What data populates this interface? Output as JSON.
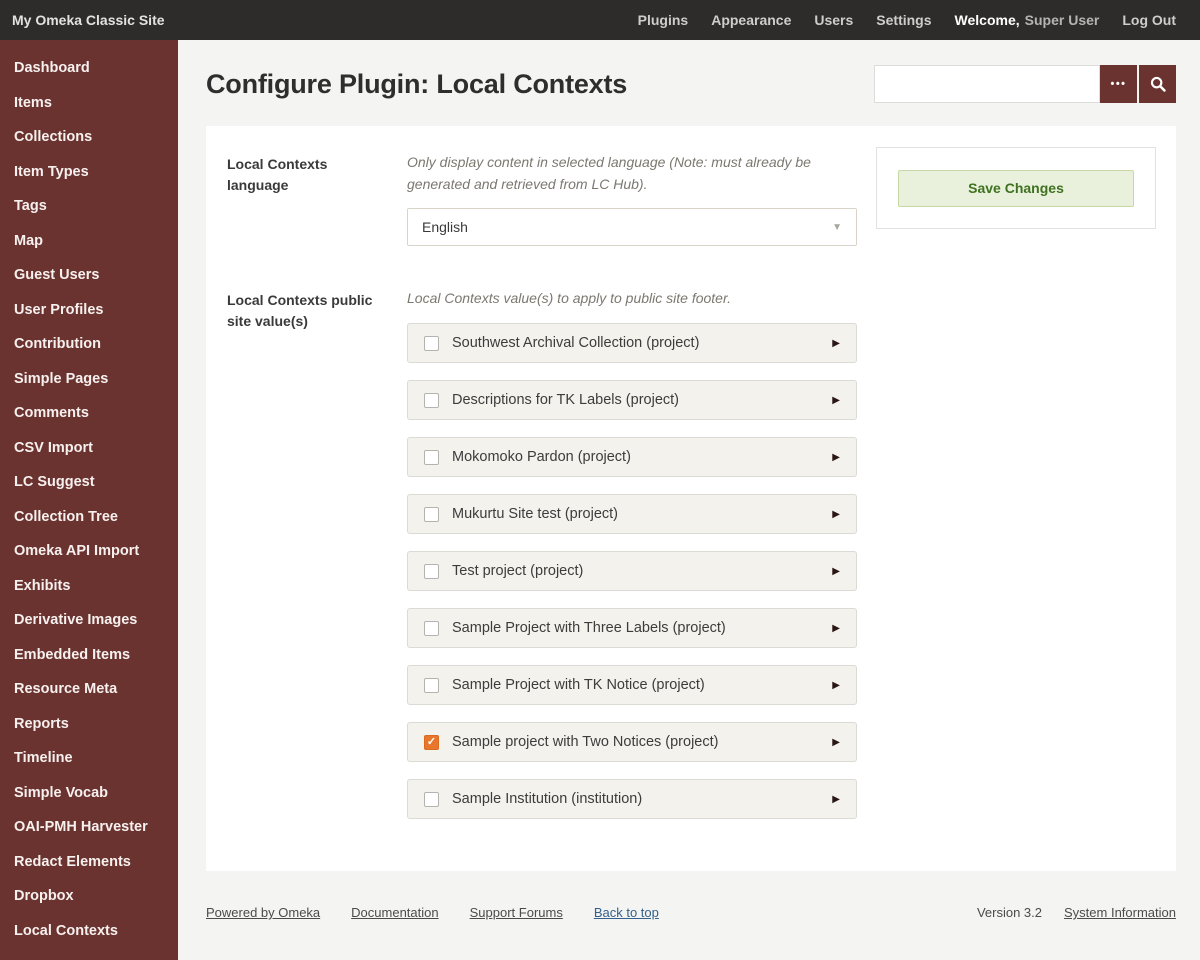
{
  "topbar": {
    "site_title": "My Omeka Classic Site",
    "nav": [
      "Plugins",
      "Appearance",
      "Users",
      "Settings"
    ],
    "welcome_bold": "Welcome,",
    "welcome_user": "Super User",
    "logout_label": "Log Out"
  },
  "sidebar": {
    "items": [
      "Dashboard",
      "Items",
      "Collections",
      "Item Types",
      "Tags",
      "Map",
      "Guest Users",
      "User Profiles",
      "Contribution",
      "Simple Pages",
      "Comments",
      "CSV Import",
      "LC Suggest",
      "Collection Tree",
      "Omeka API Import",
      "Exhibits",
      "Derivative Images",
      "Embedded Items",
      "Resource Meta",
      "Reports",
      "Timeline",
      "Simple Vocab",
      "OAI-PMH Harvester",
      "Redact Elements",
      "Dropbox",
      "Local Contexts"
    ]
  },
  "header": {
    "title": "Configure Plugin: Local Contexts",
    "search": {
      "value": "",
      "placeholder": ""
    }
  },
  "form": {
    "language_field": {
      "label": "Local Contexts language",
      "description": "Only display content in selected language (Note: must already be generated and retrieved from LC Hub).",
      "selected_value": "English"
    },
    "values_field": {
      "label": "Local Contexts public site value(s)",
      "description": "Local Contexts value(s) to apply to public site footer.",
      "options": [
        {
          "label": "Southwest Archival Collection (project)",
          "checked": false
        },
        {
          "label": "Descriptions for TK Labels (project)",
          "checked": false
        },
        {
          "label": "Mokomoko Pardon (project)",
          "checked": false
        },
        {
          "label": "Mukurtu Site test (project)",
          "checked": false
        },
        {
          "label": "Test project (project)",
          "checked": false
        },
        {
          "label": "Sample Project with Three Labels (project)",
          "checked": false
        },
        {
          "label": "Sample Project with TK Notice (project)",
          "checked": false
        },
        {
          "label": "Sample project with Two Notices (project)",
          "checked": true
        },
        {
          "label": "Sample Institution (institution)",
          "checked": false
        }
      ]
    },
    "save_button": "Save Changes"
  },
  "footer": {
    "links": [
      "Powered by Omeka",
      "Documentation",
      "Support Forums",
      "Back to top"
    ],
    "version": "Version 3.2",
    "system_info": "System Information"
  },
  "icons": {
    "ellipsis": "•••",
    "select_caret": "▼",
    "row_expand": "▶",
    "checkmark": "✓"
  },
  "colors": {
    "topbar_bg": "#2d2c2b",
    "sidebar_bg": "#6b3330",
    "accent_maroon": "#6b3330",
    "checkbox_checked_orange": "#e8772d",
    "save_button_text_green": "#3f7220",
    "save_button_bg_green": "#e9f0dc",
    "back_to_top_blue": "#33608c"
  }
}
